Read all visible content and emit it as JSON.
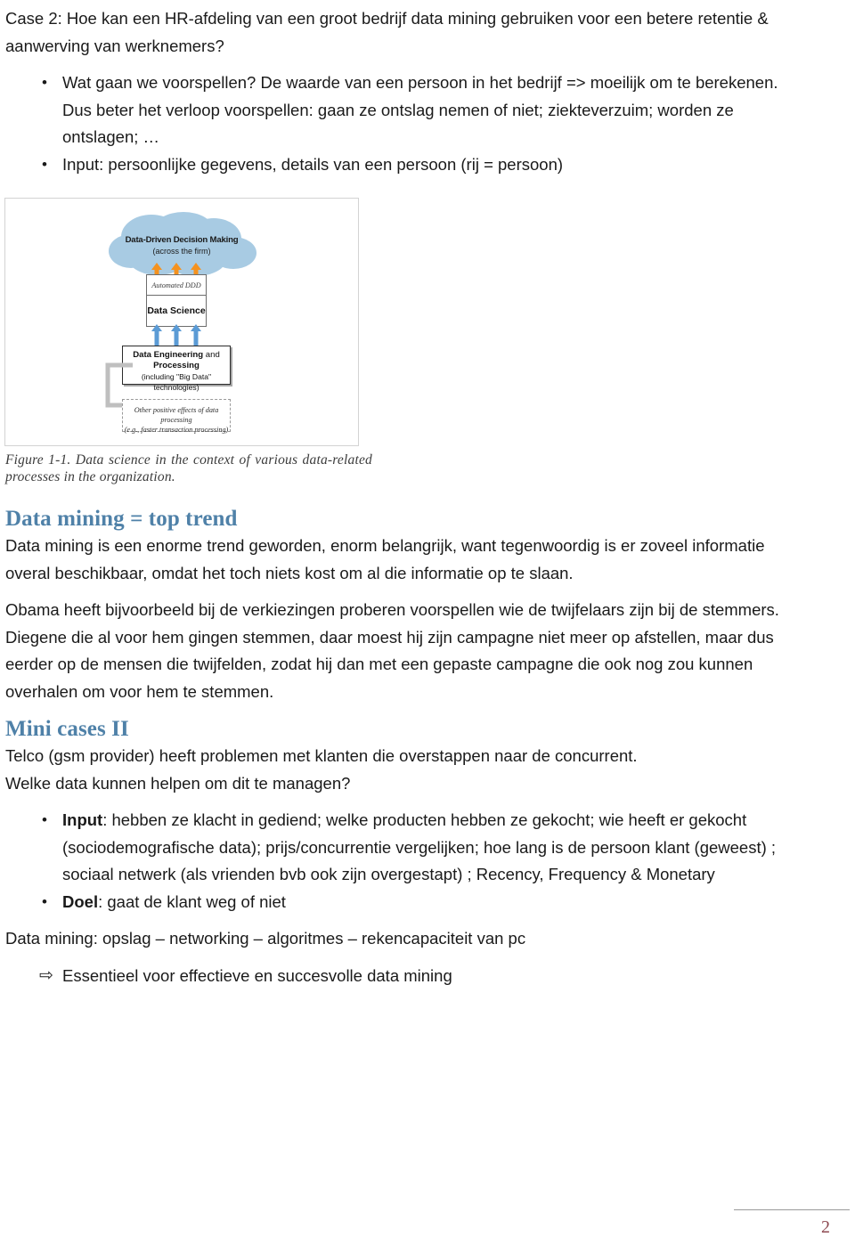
{
  "document": {
    "case_heading": "Case 2: Hoe kan een HR-afdeling van een groot bedrijf data mining gebruiken voor een betere retentie & aanwerving van werknemers?",
    "case_bullets": [
      {
        "glyph": "•",
        "lead": "",
        "text": "Wat gaan we voorspellen? De waarde van een persoon in het bedrijf => moeilijk om te berekenen. Dus beter het verloop voorspellen: gaan ze ontslag nemen of niet; ziekteverzuim; worden ze ontslagen; …"
      },
      {
        "glyph": "•",
        "lead": "",
        "text": "Input: persoonlijke gegevens, details van een persoon (rij = persoon)"
      }
    ],
    "figure": {
      "name": "figure-1-1",
      "cloud_title": "Data-Driven Decision Making",
      "cloud_subtitle": "(across the firm)",
      "automated_ddd_label": "Automated DDD",
      "data_science_label": "Data Science",
      "data_engineering_line1_bold": "Data Engineering",
      "data_engineering_line1_rest": " and",
      "data_engineering_line2": "Processing",
      "data_engineering_line3": "(including \"Big Data\" technologies)",
      "other_effects_line1": "Other positive effects of data processing",
      "other_effects_line2": "(e.g., faster transaction processing)",
      "caption": "Figure 1-1. Data science in the context of various data-related processes in the organization.",
      "colors": {
        "cloud_fill": "#a8cbe3",
        "orange_arrow": "#f5921e",
        "blue_arrow": "#5b9bd5",
        "elbow_gray": "#bfbfbf",
        "box_border": "#2b2b2b"
      }
    },
    "section_trend": {
      "heading": "Data mining = top trend",
      "paragraph_1": "Data mining is een enorme trend geworden, enorm belangrijk, want tegenwoordig is er zoveel informatie overal beschikbaar, omdat het toch niets kost om al die informatie op te slaan.",
      "paragraph_2": "Obama heeft bijvoorbeeld bij de verkiezingen proberen voorspellen wie de twijfelaars zijn bij de stemmers. Diegene die al voor hem gingen stemmen, daar moest hij zijn campagne niet meer op afstellen, maar dus eerder op de mensen die twijfelden, zodat hij dan met een gepaste campagne die ook nog zou kunnen overhalen om voor hem te stemmen."
    },
    "section_mini_cases": {
      "heading": "Mini cases II",
      "paragraph_1": "Telco (gsm provider) heeft problemen met klanten die overstappen naar de concurrent.",
      "paragraph_2": "Welke data kunnen helpen om dit te managen?",
      "bullets": [
        {
          "glyph": "•",
          "lead": "Input",
          "text": ": hebben ze klacht in gediend; welke producten hebben ze gekocht; wie heeft er gekocht (sociodemografische data); prijs/concurrentie vergelijken; hoe lang is de persoon klant (geweest) ; sociaal netwerk (als vrienden bvb ook zijn overgestapt) ; Recency, Frequency & Monetary"
        },
        {
          "glyph": "•",
          "lead": "Doel",
          "text": ": gaat de klant weg of niet"
        }
      ]
    },
    "closing": {
      "paragraph": "Data mining: opslag – networking – algoritmes – rekencapaciteit van pc",
      "bullets": [
        {
          "glyph": "⇨",
          "lead": "",
          "text": "Essentieel voor effectieve en succesvolle data mining"
        }
      ]
    },
    "footer": {
      "page_number": "2"
    }
  }
}
